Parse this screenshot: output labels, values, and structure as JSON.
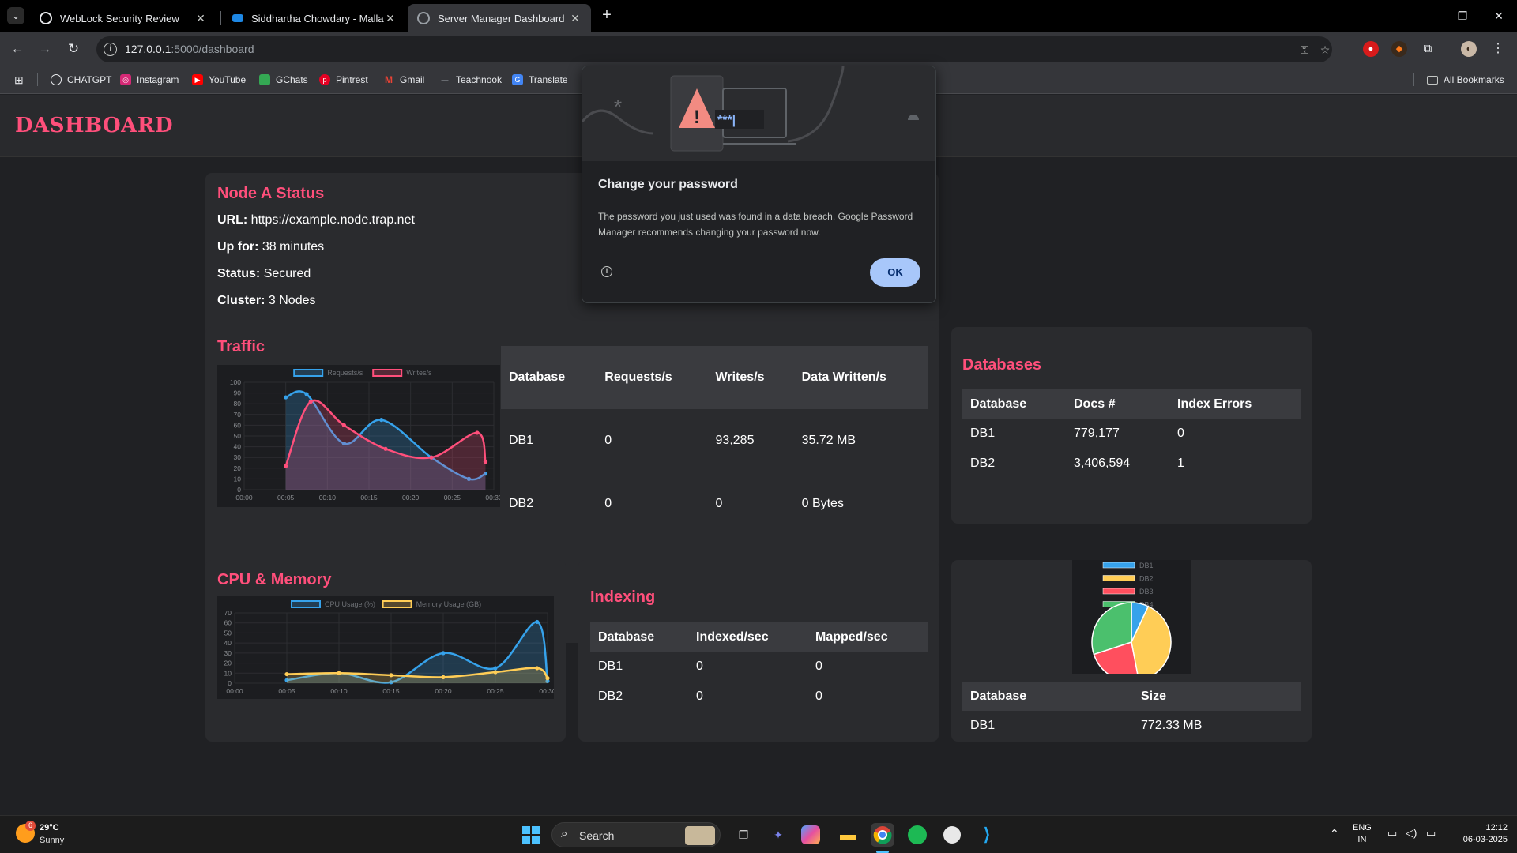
{
  "browser": {
    "tabs": [
      {
        "title": "WebLock Security Review",
        "favicon": "globe-icon",
        "active": false
      },
      {
        "title": "Siddhartha Chowdary - Malla R",
        "favicon": "cloud-icon",
        "active": false
      },
      {
        "title": "Server Manager Dashboard",
        "favicon": "globe-icon",
        "active": true
      }
    ],
    "address": {
      "host": "127.0.0.1",
      "path": ":5000/dashboard"
    },
    "bookmarks": [
      "CHATGPT",
      "Instagram",
      "YouTube",
      "GChats",
      "Pintrest",
      "Gmail",
      "Teachnook",
      "Translate"
    ],
    "all_bookmarks": "All Bookmarks"
  },
  "dialog": {
    "title": "Change your password",
    "body": "The password you just used was found in a data breach. Google Password Manager recommends changing your password now.",
    "ok_label": "OK",
    "illustration_text": "***|"
  },
  "dashboard": {
    "brand": "DASHBOARD",
    "node": {
      "title": "Node A Status",
      "url_label": "URL:",
      "url_value": "https://example.node.trap.net",
      "up_label": "Up for:",
      "up_value": "38 minutes",
      "status_label": "Status:",
      "status_value": "Secured",
      "cluster_label": "Cluster:",
      "cluster_value": "3 Nodes"
    },
    "traffic": {
      "title": "Traffic",
      "headers": [
        "Database",
        "Requests/s",
        "Writes/s",
        "Data Written/s"
      ],
      "rows": [
        [
          "DB1",
          "0",
          "93,285",
          "35.72 MB"
        ],
        [
          "DB2",
          "0",
          "0",
          "0 Bytes"
        ]
      ]
    },
    "databases": {
      "title": "Databases",
      "headers": [
        "Database",
        "Docs #",
        "Index Errors"
      ],
      "rows": [
        [
          "DB1",
          "779,177",
          "0"
        ],
        [
          "DB2",
          "3,406,594",
          "1"
        ]
      ]
    },
    "cpu": {
      "title": "CPU & Memory"
    },
    "indexing": {
      "title": "Indexing",
      "headers": [
        "Database",
        "Indexed/sec",
        "Mapped/sec"
      ],
      "rows": [
        [
          "DB1",
          "0",
          "0"
        ],
        [
          "DB2",
          "0",
          "0"
        ]
      ]
    },
    "sizes": {
      "headers": [
        "Database",
        "Size"
      ],
      "rows": [
        [
          "DB1",
          "772.33 MB"
        ]
      ]
    }
  },
  "chart_data": [
    {
      "type": "line",
      "x": [
        "00:00",
        "00:05",
        "00:10",
        "00:15",
        "00:20",
        "00:25",
        "00:30"
      ],
      "ylim": [
        0,
        100
      ],
      "yticks": [
        0,
        10,
        20,
        30,
        40,
        50,
        60,
        70,
        80,
        90,
        100
      ],
      "series": [
        {
          "name": "Requests/s",
          "color": "#36a2eb",
          "x": [
            5,
            7.5,
            12,
            16.5,
            22.5,
            27,
            29
          ],
          "values": [
            86,
            89,
            43,
            65,
            30,
            10,
            15
          ]
        },
        {
          "name": "Writes/s",
          "color": "#ff4f7b",
          "x": [
            5,
            8,
            12,
            17,
            22.5,
            28,
            29
          ],
          "values": [
            22,
            82,
            60,
            38,
            30,
            53,
            26
          ]
        }
      ]
    },
    {
      "type": "line",
      "x": [
        "00:00",
        "00:05",
        "00:10",
        "00:15",
        "00:20",
        "00:25",
        "00:30"
      ],
      "ylim": [
        0,
        70
      ],
      "yticks": [
        0,
        10,
        20,
        30,
        40,
        50,
        60,
        70
      ],
      "series": [
        {
          "name": "CPU Usage (%)",
          "color": "#36a2eb",
          "x": [
            5,
            10,
            15,
            20,
            25,
            29,
            30
          ],
          "values": [
            3,
            10,
            1,
            30,
            15,
            61,
            2
          ]
        },
        {
          "name": "Memory Usage (GB)",
          "color": "#ffcd56",
          "x": [
            5,
            10,
            15,
            20,
            25,
            29,
            30
          ],
          "values": [
            9,
            10,
            8,
            6,
            11,
            15,
            5
          ]
        }
      ]
    },
    {
      "type": "pie",
      "labels": [
        "DB1",
        "DB2",
        "DB3",
        "DB4"
      ],
      "values": [
        7,
        40,
        23,
        30
      ],
      "colors": [
        "#36a2eb",
        "#ffcd56",
        "#ff4f5e",
        "#4bc06d"
      ]
    }
  ],
  "taskbar": {
    "weather": {
      "temp": "29°C",
      "condition": "Sunny",
      "badge": "6"
    },
    "search_label": "Search",
    "lang": "ENG",
    "region": "IN",
    "time": "12:12",
    "date": "06-03-2025"
  }
}
